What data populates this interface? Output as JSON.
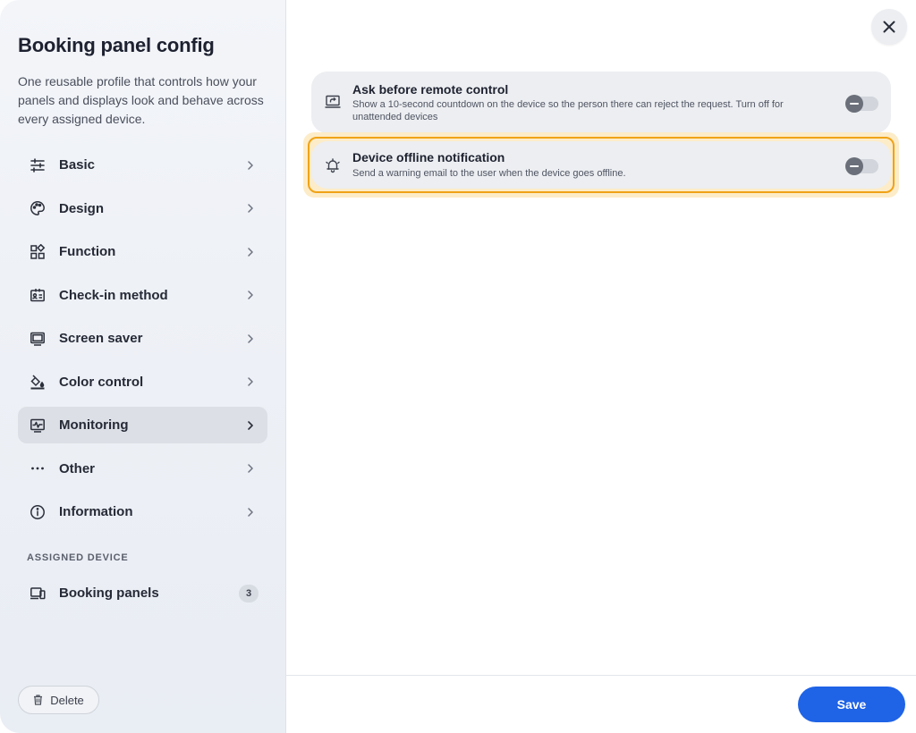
{
  "sidebar": {
    "title": "Booking panel config",
    "description": "One reusable profile that controls how your panels and displays look and behave across every assigned device.",
    "items": [
      {
        "label": "Basic",
        "icon": "sliders-icon"
      },
      {
        "label": "Design",
        "icon": "palette-icon"
      },
      {
        "label": "Function",
        "icon": "grid-icon"
      },
      {
        "label": "Check-in method",
        "icon": "id-card-icon"
      },
      {
        "label": "Screen saver",
        "icon": "monitor-icon"
      },
      {
        "label": "Color control",
        "icon": "paint-bucket-icon"
      },
      {
        "label": "Monitoring",
        "icon": "activity-monitor-icon",
        "active": true
      },
      {
        "label": "Other",
        "icon": "ellipsis-icon"
      },
      {
        "label": "Information",
        "icon": "info-icon"
      }
    ],
    "section_label": "ASSIGNED DEVICE",
    "device": {
      "label": "Booking panels",
      "count": "3",
      "icon": "devices-icon"
    },
    "delete_label": "Delete"
  },
  "main": {
    "settings": [
      {
        "title": "Ask before remote control",
        "description": "Show a 10-second countdown on the device so the person there can reject the request. Turn off for unattended devices",
        "icon": "remote-screen-icon",
        "enabled": false
      },
      {
        "title": "Device offline notification",
        "description": "Send a warning email to the user when the device goes offline.",
        "icon": "bell-alert-icon",
        "enabled": false,
        "highlighted": true
      }
    ],
    "save_label": "Save"
  },
  "colors": {
    "accent": "#1f63e6",
    "highlight_border": "#f0a316",
    "highlight_glow": "#fdecc8",
    "active_nav": "#dcdfe5"
  }
}
